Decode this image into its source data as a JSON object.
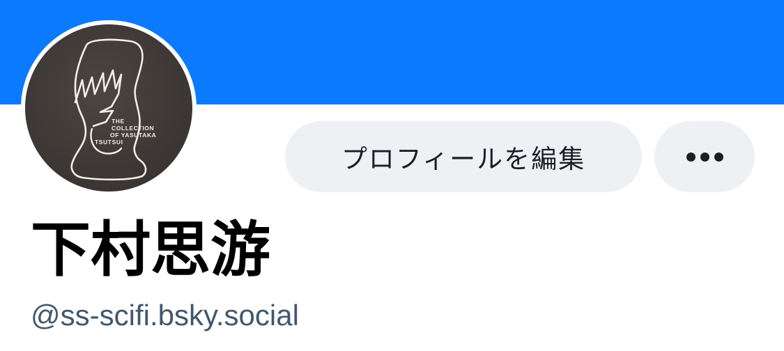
{
  "banner": {
    "color": "#0a7aff"
  },
  "avatar": {
    "icon": "tsutsui-collection-logo-avatar",
    "logo_text": [
      "THE",
      "COLLECTION",
      "OF YASUTAKA",
      "TSUTSUI"
    ]
  },
  "actions": {
    "edit_profile_label": "プロフィールを編集",
    "more_icon": "ellipsis-icon"
  },
  "profile": {
    "display_name": "下村思游",
    "handle": "@ss-scifi.bsky.social"
  }
}
